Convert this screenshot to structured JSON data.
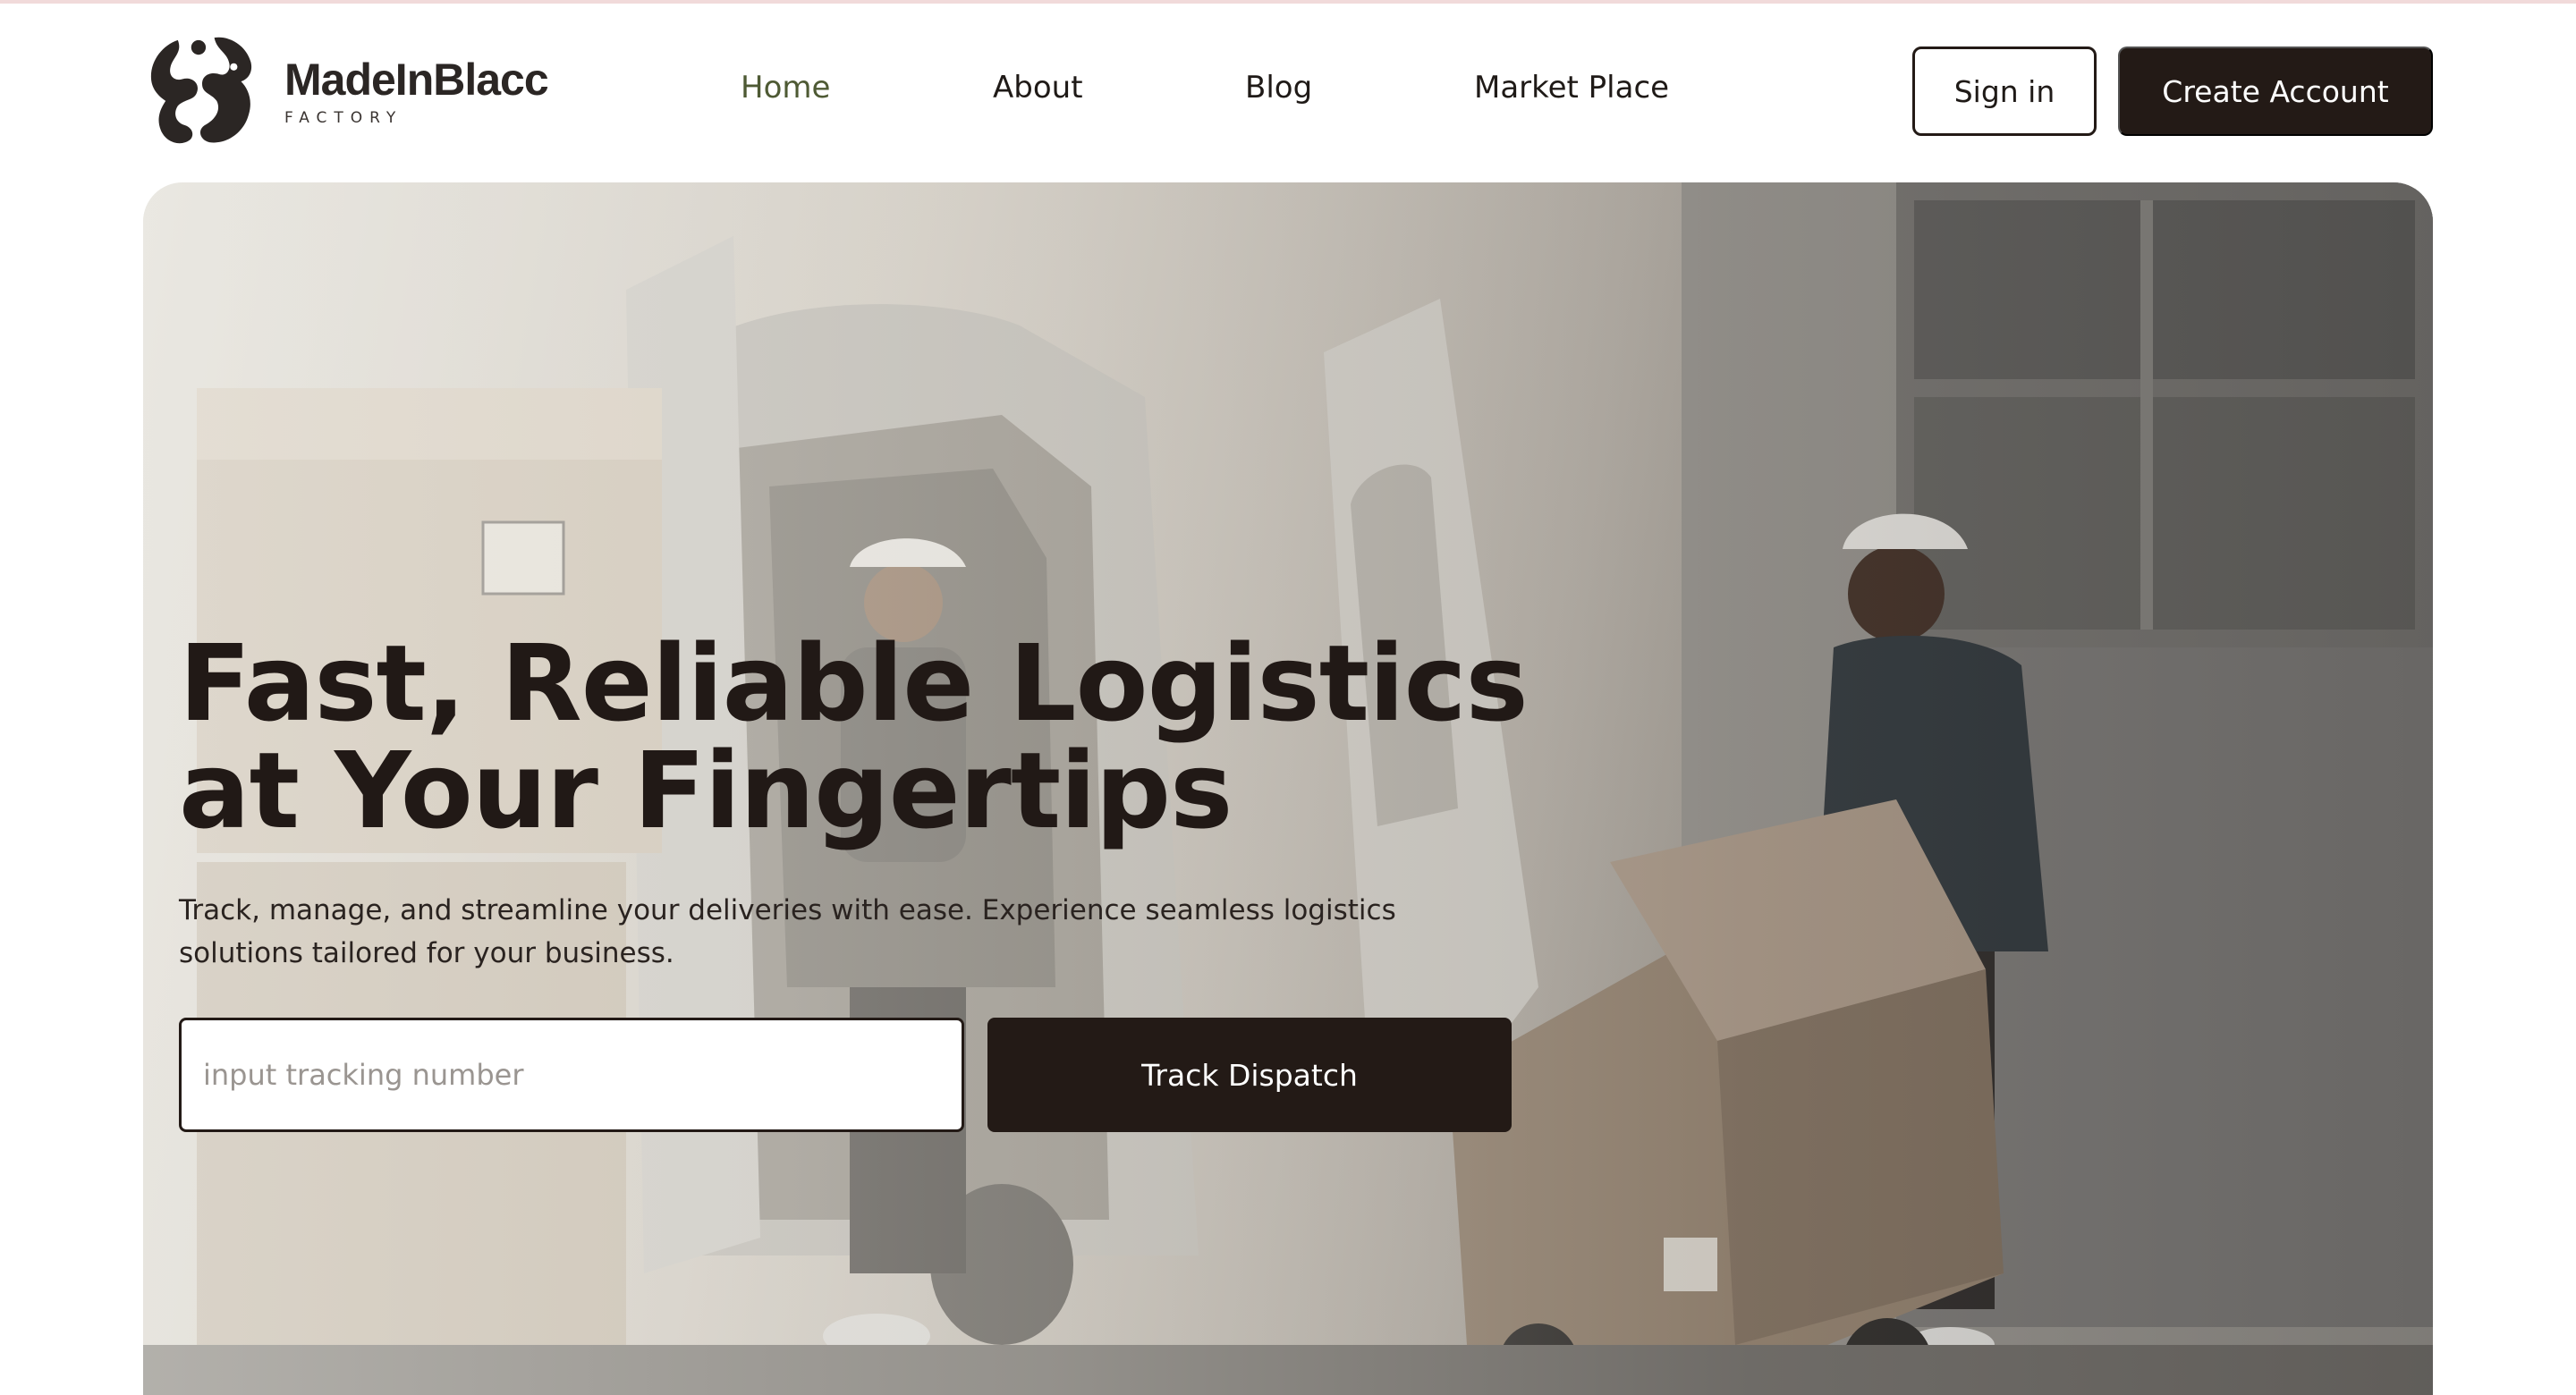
{
  "brand": {
    "name": "MadeInBlacc",
    "subtitle": "FACTORY"
  },
  "nav": {
    "home": "Home",
    "about": "About",
    "blog": "Blog",
    "market_place": "Market Place",
    "active": "home"
  },
  "auth": {
    "sign_in": "Sign in",
    "create_account": "Create Account"
  },
  "hero": {
    "title_line1": "Fast, Reliable Logistics",
    "title_line2": "at Your Fingertips",
    "description": "Track, manage, and streamline your deliveries with ease. Experience seamless logistics solutions tailored for your business.",
    "tracking_placeholder": "input tracking number",
    "track_button": "Track Dispatch",
    "background_image": "delivery-workers-unloading-van-photo"
  },
  "colors": {
    "primary_dark": "#231a16",
    "active_nav": "#4e5a34",
    "top_rule": "#f1dada"
  },
  "icons": {
    "logo": "made-in-blacc-hands-logo"
  }
}
